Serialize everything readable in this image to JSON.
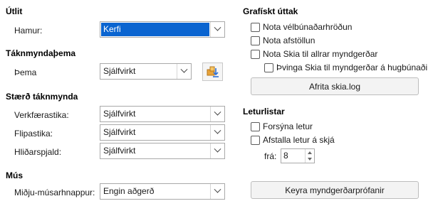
{
  "left": {
    "utlit": {
      "title": "Útlit",
      "hamur_label": "Hamur:",
      "hamur_value": "Kerfi"
    },
    "icon_theme": {
      "title": "Táknmyndaþema",
      "theme_label": "Þema",
      "theme_value": "Sjálfvirkt",
      "add_icon": "add-theme-icon"
    },
    "icon_size": {
      "title": "Stærð táknmynda",
      "toolbar_label": "Verkfærastika:",
      "toolbar_value": "Sjálfvirkt",
      "tabbar_label": "Flipastika:",
      "tabbar_value": "Sjálfvirkt",
      "sidebar_label": "Hliðarspjald:",
      "sidebar_value": "Sjálfvirkt"
    },
    "mouse": {
      "title": "Mús",
      "middle_label": "Miðju-músarhnappur:",
      "middle_value": "Engin aðgerð"
    }
  },
  "right": {
    "graphics": {
      "title": "Grafískt úttak",
      "hw_accel": "Nota vélbúnaðarhröðun",
      "antialias": "Nota afstöllun",
      "skia": "Nota Skia til allrar myndgerðar",
      "skia_sw": "Þvinga Skia til myndgerðar á hugbúnaði",
      "copy_log": "Afrita skia.log"
    },
    "fonts": {
      "title": "Leturlistar",
      "preview": "Forsýna letur",
      "aa_screen": "Afstalla letur á skjá",
      "from_label": "frá:",
      "from_value": "8",
      "run_test": "Keyra myndgerðarprófanir"
    }
  },
  "colors": {
    "selection": "#0a64d0",
    "icon_accent": "#e8a33a",
    "icon_blue": "#2f6fd6"
  }
}
